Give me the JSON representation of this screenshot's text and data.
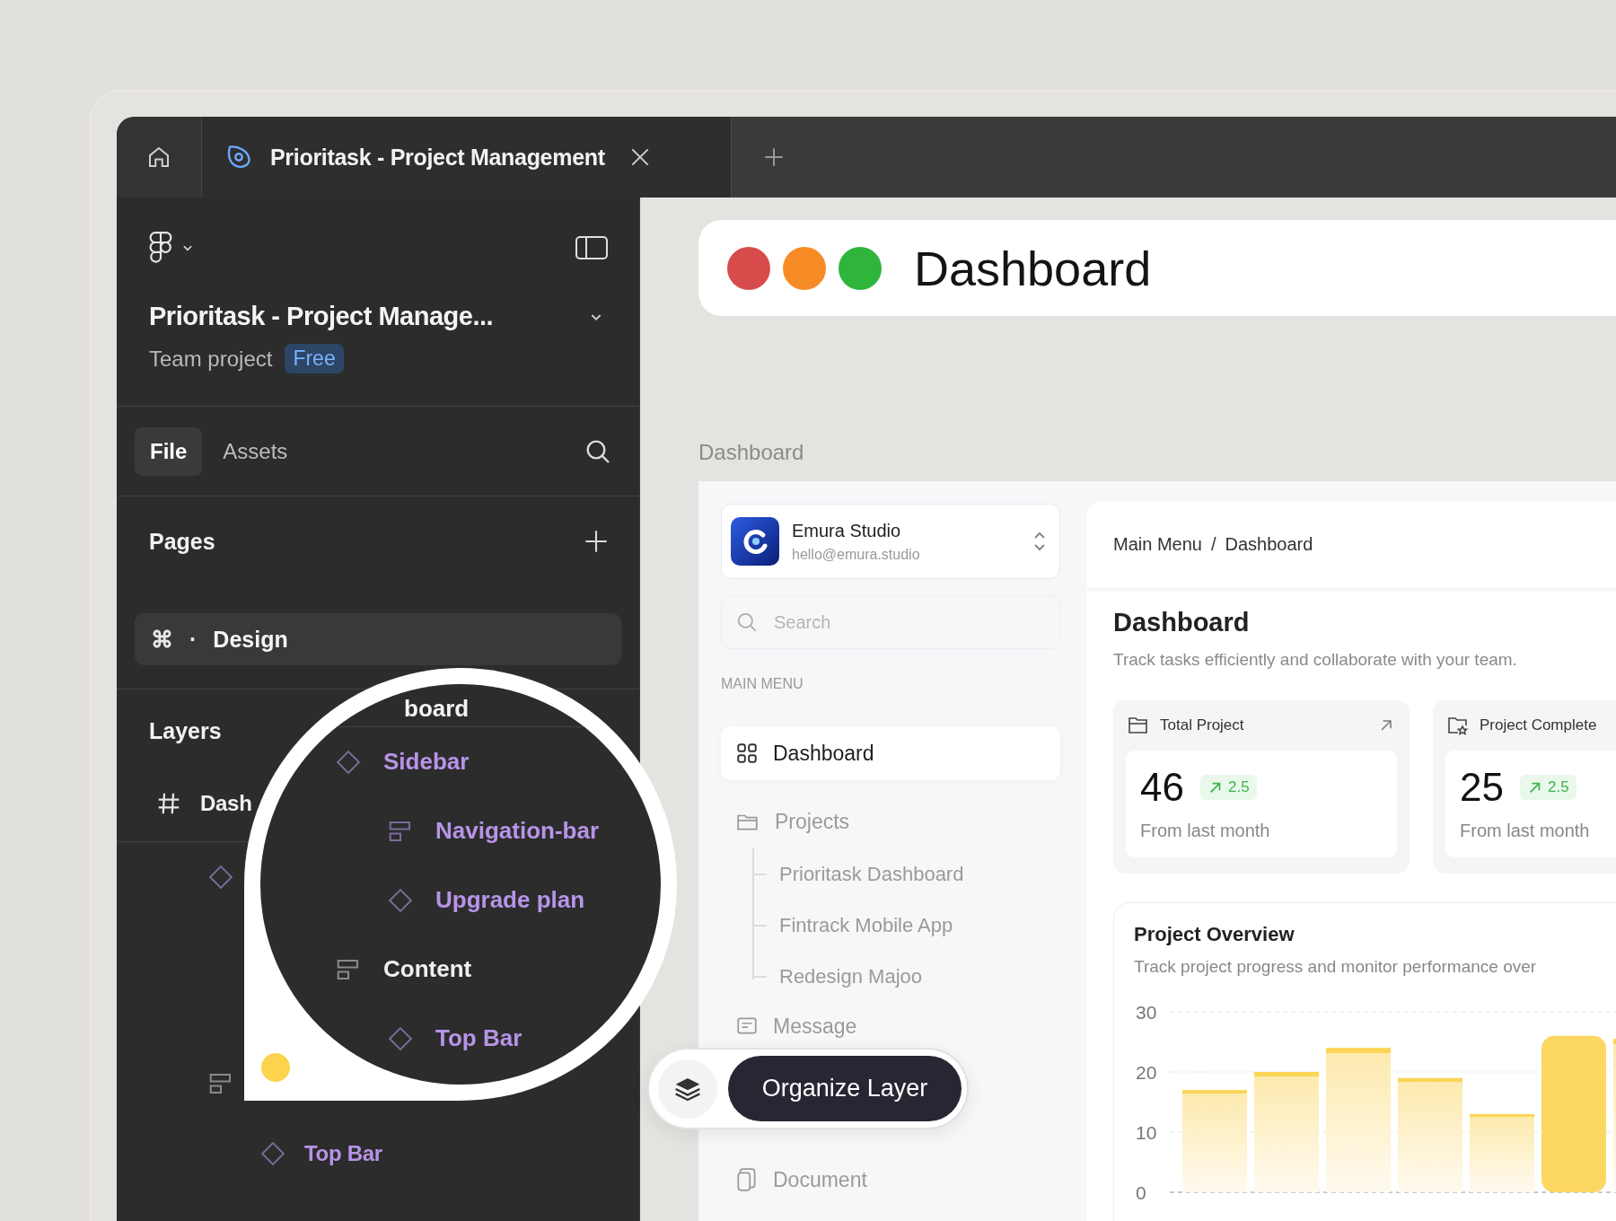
{
  "tab_bar": {
    "tab": {
      "title": "Prioritask - Project Management",
      "selected": true
    }
  },
  "file_panel": {
    "title": "Prioritask - Project Manage...",
    "subtitle": "Team project",
    "plan": "Free",
    "tabs": [
      {
        "label": "File",
        "selected": true
      },
      {
        "label": "Assets",
        "selected": false
      }
    ],
    "pages_heading": "Pages",
    "pages": [
      {
        "shortcut": "⌘",
        "separator": "·",
        "label": "Design",
        "selected": true
      }
    ],
    "layers_heading": "Layers",
    "layers": [
      {
        "kind": "frame",
        "label": "Dash",
        "instance": false,
        "children": [
          {
            "kind": "component",
            "instance": true
          },
          {
            "kind": "autolayout",
            "instance": false,
            "children": [
              {
                "kind": "component",
                "label": "Top Bar",
                "instance": true
              }
            ]
          }
        ]
      }
    ]
  },
  "magnifier": {
    "heading": "board",
    "layers": [
      {
        "kind": "component",
        "label": "Sidebar",
        "instance": true,
        "children": [
          {
            "kind": "autolayout",
            "label": "Navigation-bar",
            "instance": true
          },
          {
            "kind": "component",
            "label": "Upgrade plan",
            "instance": true
          }
        ]
      },
      {
        "kind": "autolayout",
        "label": "Content",
        "instance": false,
        "children": [
          {
            "kind": "component",
            "label": "Top Bar",
            "instance": true
          }
        ]
      }
    ]
  },
  "hint": {
    "label": "Organize Layer"
  },
  "canvas": {
    "title_card": {
      "title": "Dashboard",
      "dots": [
        {
          "color": "#d84b4b"
        },
        {
          "color": "#f78b25"
        },
        {
          "color": "#2fb53c"
        }
      ]
    },
    "frame_label": "Dashboard",
    "app": {
      "workspace": {
        "name": "Emura Studio",
        "email": "hello@emura.studio"
      },
      "search": {
        "placeholder": "Search"
      },
      "section": "MAIN MENU",
      "menu": [
        {
          "kind": "grid",
          "label": "Dashboard",
          "selected": true
        },
        {
          "kind": "folder",
          "label": "Projects",
          "selected": false,
          "children": [
            {
              "label": "Prioritask Dashboard"
            },
            {
              "label": "Fintrack Mobile App"
            },
            {
              "label": "Redesign Majoo"
            }
          ]
        },
        {
          "kind": "message",
          "label": "Message",
          "selected": false
        },
        {
          "kind": "document",
          "label": "Document",
          "selected": false
        }
      ],
      "breadcrumb": [
        "Main Menu",
        "Dashboard"
      ],
      "breadcrumb_separator": "/",
      "title": "Dashboard",
      "subtitle": "Track tasks efficiently and collaborate with your team.",
      "stats": [
        {
          "kind": "folder",
          "label": "Total Project",
          "value": "46",
          "change": "2.5",
          "note": "From last month"
        },
        {
          "kind": "folder-star",
          "label": "Project Complete",
          "value": "25",
          "change": "2.5",
          "note": "From last month"
        }
      ],
      "overview": {
        "title": "Project Overview",
        "subtitle": "Track project progress and monitor performance over",
        "chart_data": {
          "type": "bar",
          "values": [
            17,
            20,
            24,
            19,
            13,
            26,
            25.5
          ],
          "ylim": [
            0,
            30
          ],
          "yticks": [
            0,
            10,
            20,
            30
          ]
        }
      }
    }
  }
}
